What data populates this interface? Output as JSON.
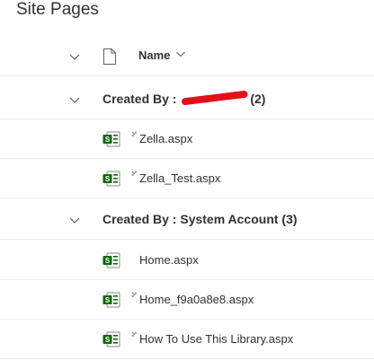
{
  "library": {
    "title": "Site Pages"
  },
  "header": {
    "name_label": "Name"
  },
  "groups": [
    {
      "label_prefix": "Created By : ",
      "label_suffix": "(2)",
      "files": [
        {
          "name": "Zella.aspx",
          "is_new": true
        },
        {
          "name": "Zella_Test.aspx",
          "is_new": true
        }
      ]
    },
    {
      "label": "Created By : System Account (3)",
      "files": [
        {
          "name": "Home.aspx",
          "is_new": false
        },
        {
          "name": "Home_f9a0a8e8.aspx",
          "is_new": true
        },
        {
          "name": "How To Use This Library.aspx",
          "is_new": true
        }
      ]
    }
  ],
  "colors": {
    "text": "#323130",
    "divider": "#edebe9",
    "sharepoint_green": "#0b6a0b",
    "new_indicator": "#8764b8",
    "redaction": "#e3101a"
  },
  "icons": {
    "collapse": "chevron-down-icon",
    "document_header": "document-icon",
    "page_file": "sharepoint-page-icon",
    "new_item": "new-item-icon"
  }
}
